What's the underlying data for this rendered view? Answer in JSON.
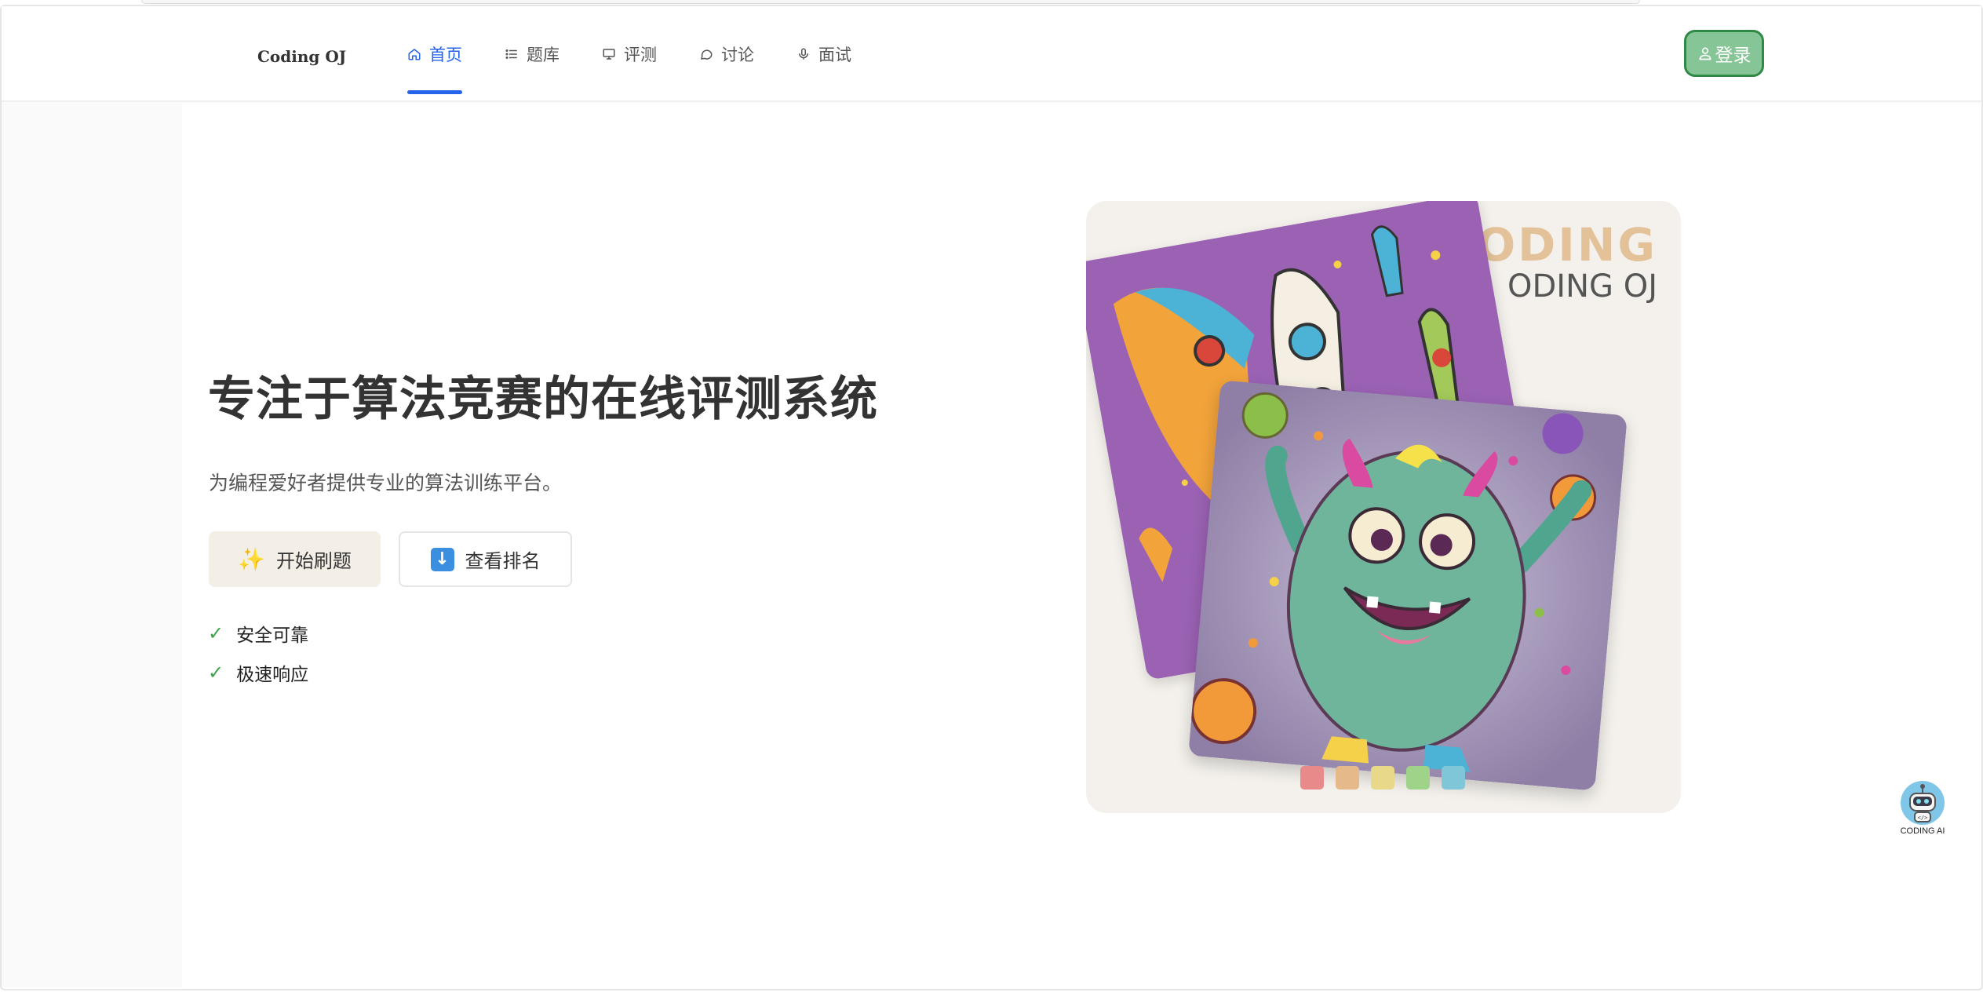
{
  "app": {
    "brand": "Coding OJ"
  },
  "nav": {
    "items": [
      {
        "label": "首页",
        "icon": "home-icon",
        "active": true
      },
      {
        "label": "题库",
        "icon": "list-icon",
        "active": false
      },
      {
        "label": "评测",
        "icon": "monitor-icon",
        "active": false
      },
      {
        "label": "讨论",
        "icon": "chat-icon",
        "active": false
      },
      {
        "label": "面试",
        "icon": "microphone-icon",
        "active": false
      }
    ],
    "active_color": "#2563eb"
  },
  "header": {
    "login_label": "登录",
    "login_icon": "user-icon",
    "login_color": "#86c596"
  },
  "hero": {
    "title": "专注于算法竞赛的在线评测系统",
    "subtitle": "为编程爱好者提供专业的算法训练平台。",
    "primary_button": {
      "label": "开始刷题",
      "icon": "sparkles-icon"
    },
    "secondary_button": {
      "label": "查看排名",
      "icon": "down-arrow-icon"
    },
    "features": [
      "安全可靠",
      "极速响应"
    ]
  },
  "showcase": {
    "brand_line_1": "ODING",
    "brand_line_2": "ODING OJ",
    "swatch_colors": [
      "#e88a8a",
      "#e6b98a",
      "#e8d88a",
      "#9fd38a",
      "#7fc6d9"
    ]
  },
  "ai_assistant": {
    "label": "CODING AI",
    "icon": "robot-icon"
  }
}
